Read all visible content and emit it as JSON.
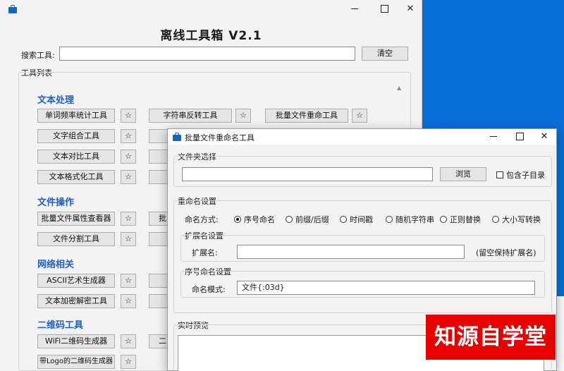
{
  "main": {
    "title": "离线工具箱  V2.1",
    "search_label": "搜索工具:",
    "search_value": "",
    "clear_label": "清空",
    "tool_list_label": "工具列表",
    "star": "☆",
    "sections": {
      "text": {
        "title": "文本处理",
        "items": [
          "单词频率统计工具",
          "文字组合工具",
          "文本对比工具",
          "文本格式化工具"
        ],
        "col2": [
          "字符串反转工具",
          "",
          "",
          ""
        ],
        "col3": [
          "批量文件重命工具"
        ]
      },
      "file": {
        "title": "文件操作",
        "items": [
          "批量文件属性查看器",
          "文件分割工具"
        ],
        "col2": [
          "批",
          ""
        ]
      },
      "net": {
        "title": "网络相关",
        "items": [
          "ASCII艺术生成器",
          "文本加密解密工具"
        ]
      },
      "qr": {
        "title": "二维码工具",
        "items": [
          "WiFi二维码生成器",
          "带Logo的二维码生成器"
        ],
        "col2": [
          "二",
          ""
        ]
      }
    }
  },
  "dialog": {
    "title": "批量文件重命名工具",
    "folder_section": "文件夹选择",
    "folder_value": "",
    "browse_label": "浏览",
    "include_sub_label": "包含子目录",
    "rename_section": "重命名设置",
    "method_label": "命名方式:",
    "methods": [
      {
        "label": "序号命名",
        "selected": true
      },
      {
        "label": "前缀/后缀",
        "selected": false
      },
      {
        "label": "时间戳",
        "selected": false
      },
      {
        "label": "随机字符串",
        "selected": false
      },
      {
        "label": "正则替换",
        "selected": false
      },
      {
        "label": "大小写转换",
        "selected": false
      }
    ],
    "ext_section": "扩展名设置",
    "ext_label": "扩展名:",
    "ext_value": "",
    "ext_hint": "(留空保持扩展名)",
    "seq_section": "序号命名设置",
    "pattern_label": "命名模式:",
    "pattern_value": "文件{:03d}",
    "preview_section": "实时预览"
  },
  "watermark": "知源自学堂"
}
